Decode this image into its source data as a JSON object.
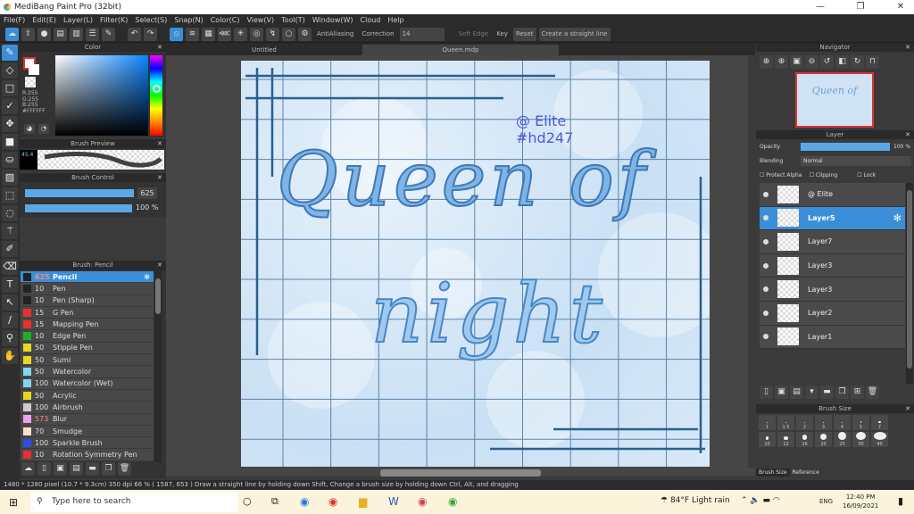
{
  "window": {
    "title": "MediBang Paint Pro (32bit)",
    "minimize": "—",
    "maximize": "❐",
    "close": "✕"
  },
  "menu": [
    "File(F)",
    "Edit(E)",
    "Layer(L)",
    "Filter(K)",
    "Select(S)",
    "Snap(N)",
    "Color(C)",
    "View(V)",
    "Tool(T)",
    "Window(W)",
    "Cloud",
    "Help"
  ],
  "toolbar": {
    "antialiasing": "AntiAliasing",
    "correction_label": "Correction",
    "correction_value": "14",
    "soft_edge": "Soft Edge",
    "key": "Key",
    "reset": "Reset",
    "straight_line": "Create a straight line"
  },
  "tools": [
    "brush",
    "eraser",
    "rectangle",
    "dot",
    "move",
    "fill-rect",
    "bucket",
    "gradient",
    "select",
    "lasso",
    "magic-wand",
    "select-pen",
    "select-eraser",
    "text",
    "operation",
    "divide",
    "eyedropper",
    "hand"
  ],
  "color_panel": {
    "title": "Color",
    "r": "R:255",
    "g": "G:255",
    "b": "B:255",
    "hex": "#FFFFFF"
  },
  "brush_preview": {
    "title": "Brush Preview",
    "size": "45.4"
  },
  "brush_control": {
    "title": "Brush Control",
    "size": "625",
    "opacity": "100 %"
  },
  "brush_list": {
    "title": "Brush: Pencil",
    "items": [
      {
        "size": "625",
        "name": "Pencil",
        "color": "#222222",
        "selected": true
      },
      {
        "size": "10",
        "name": "Pen",
        "color": "#222222"
      },
      {
        "size": "10",
        "name": "Pen (Sharp)",
        "color": "#222222"
      },
      {
        "size": "15",
        "name": "G Pen",
        "color": "#e83030"
      },
      {
        "size": "15",
        "name": "Mapping Pen",
        "color": "#e83030"
      },
      {
        "size": "10",
        "name": "Edge Pen",
        "color": "#22b022"
      },
      {
        "size": "50",
        "name": "Stipple Pen",
        "color": "#e8d820"
      },
      {
        "size": "50",
        "name": "Sumi",
        "color": "#e8d820"
      },
      {
        "size": "50",
        "name": "Watercolor",
        "color": "#7fd8f0"
      },
      {
        "size": "100",
        "name": "Watercolor (Wet)",
        "color": "#7fd8f0"
      },
      {
        "size": "50",
        "name": "Acrylic",
        "color": "#e8d820"
      },
      {
        "size": "100",
        "name": "Airbrush",
        "color": "#cccccc"
      },
      {
        "size": "573",
        "name": "Blur",
        "color": "#f0a0f0"
      },
      {
        "size": "70",
        "name": "Smudge",
        "color": "#fde0c8"
      },
      {
        "size": "100",
        "name": "Sparkle Brush",
        "color": "#2850e8"
      },
      {
        "size": "10",
        "name": "Rotation Symmetry Pen",
        "color": "#e83030"
      }
    ]
  },
  "tabs": [
    "Untitled",
    "Queen.mdp"
  ],
  "artwork": {
    "watermark_line1": "@ Elite",
    "watermark_line2": "#hd247",
    "title_line1": "Queen of",
    "title_line2": "night"
  },
  "navigator": {
    "title": "Navigator"
  },
  "layer_panel": {
    "title": "Layer",
    "opacity_label": "Opacity",
    "opacity_value": "100 %",
    "opacity": 1.0,
    "blending_label": "Blending",
    "blending_value": "Normal",
    "protect_alpha": "Protect Alpha",
    "clipping": "Clipping",
    "lock": "Lock",
    "layers": [
      {
        "name": "@ Elite"
      },
      {
        "name": "Layer5",
        "selected": true
      },
      {
        "name": "Layer7"
      },
      {
        "name": "Layer3"
      },
      {
        "name": "Layer3"
      },
      {
        "name": "Layer2"
      },
      {
        "name": "Layer1"
      }
    ]
  },
  "brush_size": {
    "title": "Brush Size",
    "sizes": [
      "1",
      "1.5",
      "2",
      "3",
      "4",
      "5",
      "7",
      "10",
      "12",
      "16",
      "20",
      "25",
      "30",
      "40"
    ],
    "tabs": [
      "Brush Size",
      "Reference"
    ]
  },
  "status": "1480 * 1280 pixel   (10.7 * 9.3cm)   350 dpi   66 %   ( 1587, 653 )   Draw a straight line by holding down Shift, Change a brush size by holding down Ctrl, Alt, and dragging",
  "taskbar": {
    "search_placeholder": "Type here to search",
    "weather": "84°F  Light rain",
    "lang": "ENG",
    "time": "12:40 PM",
    "date": "16/09/2021"
  },
  "colors": {
    "accent": "#3b8fd8",
    "panel": "#333333"
  }
}
